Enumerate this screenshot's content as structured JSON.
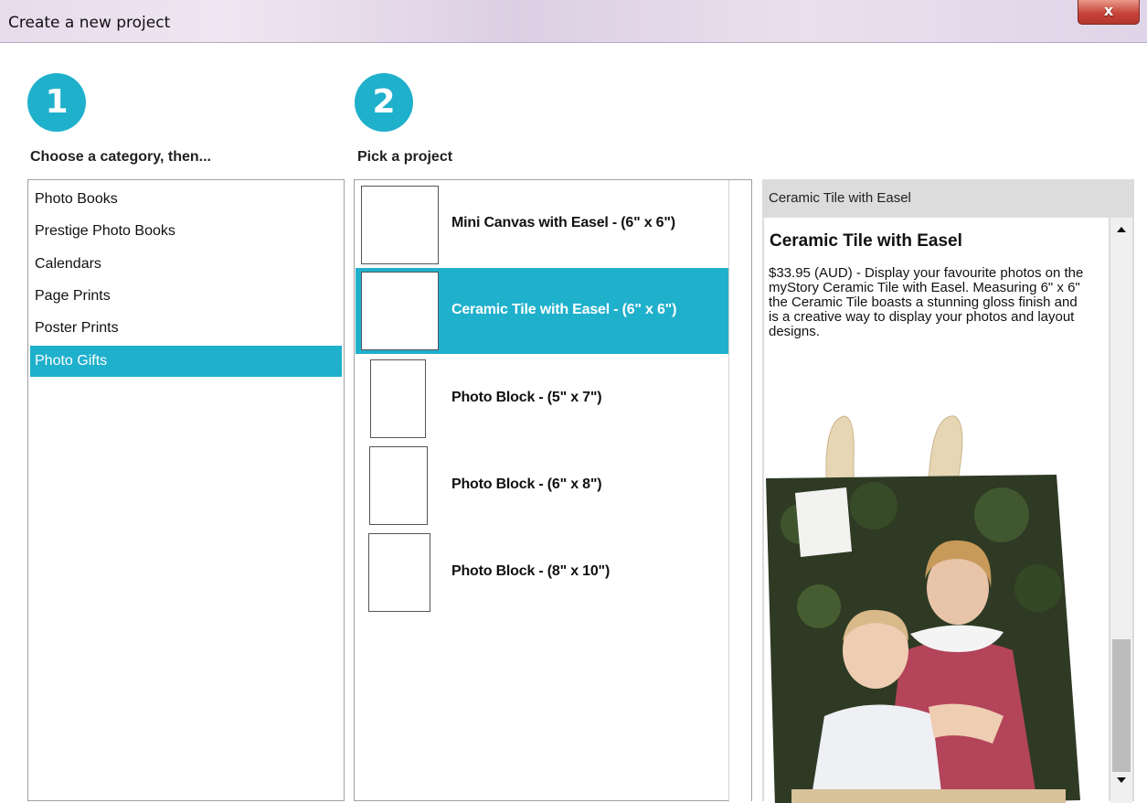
{
  "window": {
    "title": "Create a new project",
    "close_label": "x"
  },
  "steps": [
    {
      "number": "1",
      "heading": "Choose a category, then..."
    },
    {
      "number": "2",
      "heading": "Pick a project"
    }
  ],
  "categories": [
    {
      "label": "Photo Books",
      "selected": false
    },
    {
      "label": "Prestige Photo Books",
      "selected": false
    },
    {
      "label": "Calendars",
      "selected": false
    },
    {
      "label": "Page Prints",
      "selected": false
    },
    {
      "label": "Poster Prints",
      "selected": false
    },
    {
      "label": "Photo Gifts",
      "selected": true
    }
  ],
  "projects": [
    {
      "label": "Mini Canvas with Easel - (6\" x 6\")",
      "selected": false
    },
    {
      "label": "Ceramic Tile with Easel - (6\" x 6\")",
      "selected": true
    },
    {
      "label": "Photo Block - (5\" x 7\")",
      "selected": false
    },
    {
      "label": "Photo Block - (6\" x 8\")",
      "selected": false
    },
    {
      "label": "Photo Block - (8\" x 10\")",
      "selected": false
    }
  ],
  "detail": {
    "header": "Ceramic Tile with Easel",
    "title": "Ceramic Tile with Easel",
    "description": "$33.95 (AUD) - Display your favourite photos on the myStory Ceramic Tile with Easel. Measuring 6\" x 6\" the Ceramic Tile boasts a stunning gloss finish and is a creative way to display your photos and layout designs."
  },
  "colors": {
    "accent": "#1fb0cc",
    "selection": "#1fb0cc",
    "close_button": "#c8443a"
  }
}
